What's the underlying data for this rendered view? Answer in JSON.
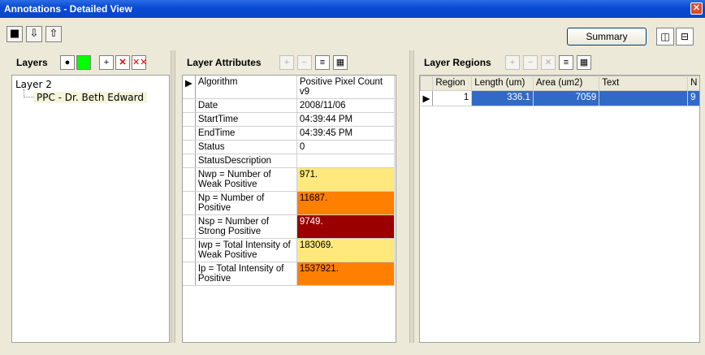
{
  "window": {
    "title": "Annotations - Detailed View",
    "close_label": "x"
  },
  "toolbar": {
    "buttons": [
      {
        "icon": "save-icon",
        "glyph": "■"
      },
      {
        "icon": "export-icon",
        "glyph": "⇩"
      },
      {
        "icon": "import-icon",
        "glyph": "⇧"
      }
    ],
    "summary_label": "Summary",
    "view_buttons": [
      {
        "icon": "horizontal-layout-icon",
        "glyph": "◫"
      },
      {
        "icon": "vertical-layout-icon",
        "glyph": "⊟"
      }
    ]
  },
  "layers": {
    "title": "Layers",
    "root": "Layer 2",
    "child": "PPC - Dr. Beth Edward",
    "color": "#00ff00"
  },
  "attributes": {
    "title": "Layer Attributes",
    "rows": [
      {
        "name": "Algorithm",
        "value": "Positive Pixel Count v9",
        "color": ""
      },
      {
        "name": "Date",
        "value": "2008/11/06",
        "color": ""
      },
      {
        "name": "StartTime",
        "value": "04:39:44 PM",
        "color": ""
      },
      {
        "name": "EndTime",
        "value": "04:39:45 PM",
        "color": ""
      },
      {
        "name": "Status",
        "value": "0",
        "color": ""
      },
      {
        "name": "StatusDescription",
        "value": "",
        "color": ""
      },
      {
        "name": "Nwp = Number of Weak Positive",
        "value": "971.",
        "color": "#ffe87c"
      },
      {
        "name": "Np  = Number of Positive",
        "value": "11687.",
        "color": "#ff8000"
      },
      {
        "name": "Nsp = Number of Strong Positive",
        "value": "9749.",
        "color": "#9b0000"
      },
      {
        "name": "Iwp = Total Intensity of Weak Positive",
        "value": "183069.",
        "color": "#ffe87c"
      },
      {
        "name": "Ip  = Total Intensity of Positive",
        "value": "1537921.",
        "color": "#ff8000"
      }
    ]
  },
  "regions": {
    "title": "Layer Regions",
    "columns": [
      "Region",
      "Length (um)",
      "Area (um2)",
      "Text",
      "N"
    ],
    "rows": [
      {
        "region": "1",
        "length": "336.1",
        "area": "7059",
        "text": "",
        "n": "9"
      }
    ]
  }
}
